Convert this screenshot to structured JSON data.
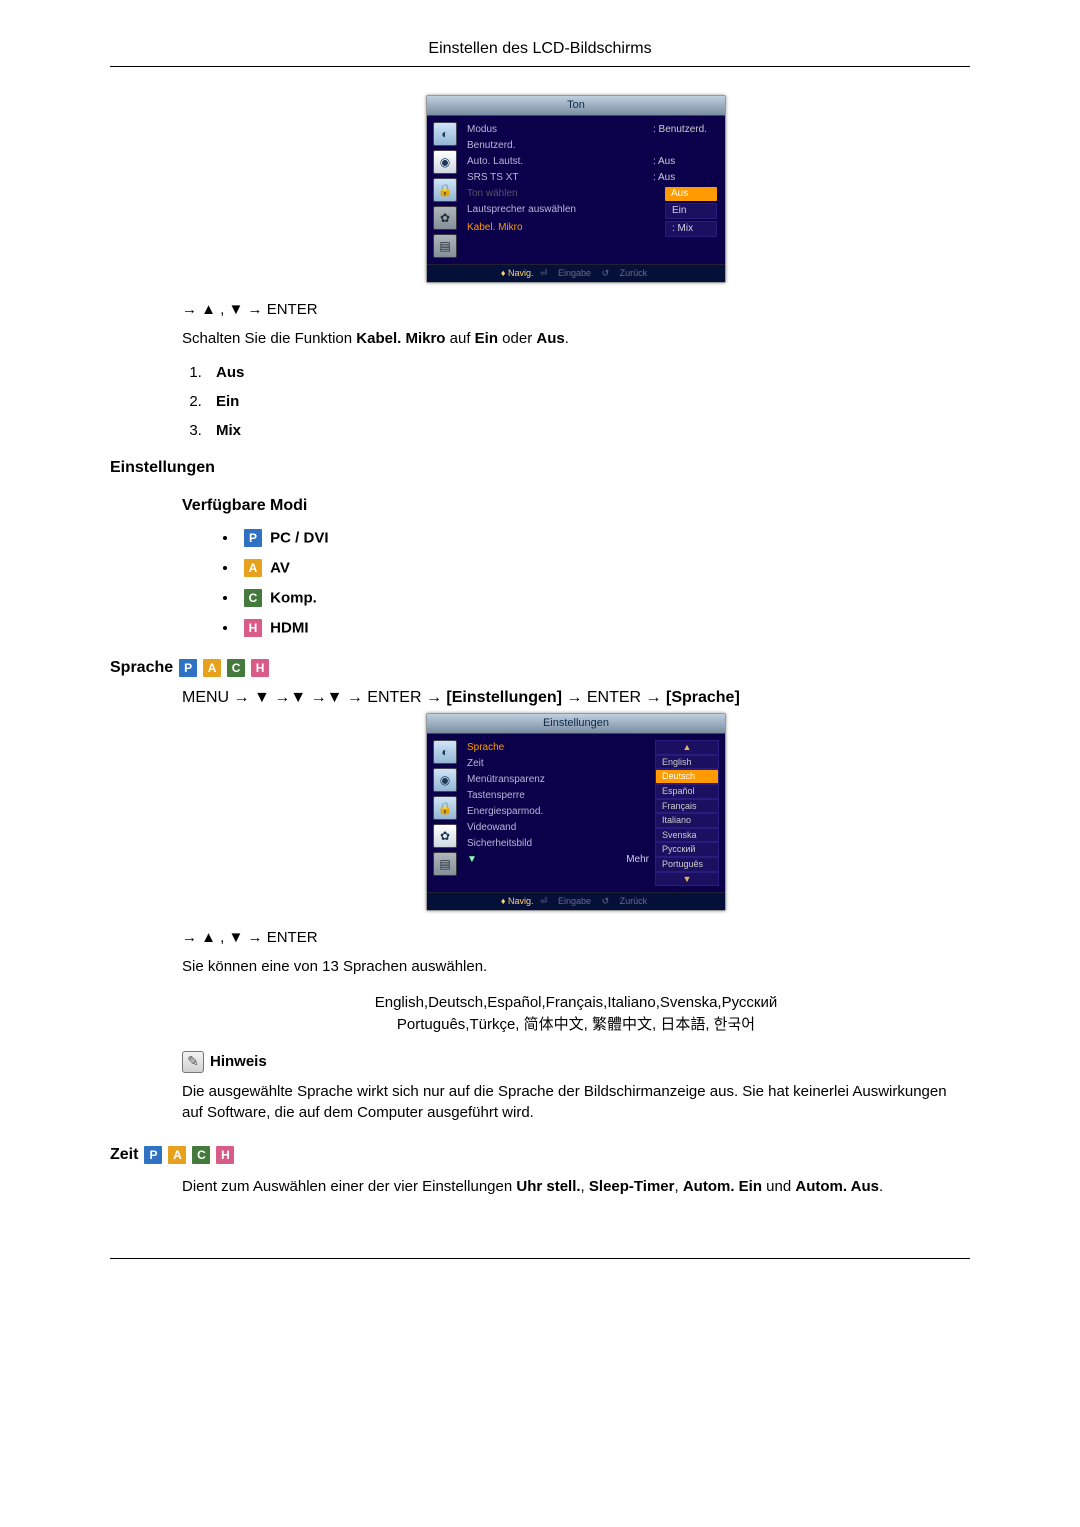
{
  "page_header": "Einstellen des LCD-Bildschirms",
  "osd1": {
    "title": "Ton",
    "rows": [
      {
        "label": "Modus",
        "value": ": Benutzerd."
      },
      {
        "label": "Benutzerd.",
        "value": ""
      },
      {
        "label": "Auto. Lautst.",
        "value": ": Aus"
      },
      {
        "label": "SRS TS XT",
        "value": ": Aus"
      },
      {
        "label_dim": "Ton wählen",
        "value_hl": "Aus"
      },
      {
        "label": "Lautsprecher auswählen",
        "value_chip": "Ein"
      },
      {
        "label_sel": "Kabel. Mikro",
        "value_chip": ": Mix"
      }
    ],
    "footer": {
      "nav": "Navig.",
      "enter": "Eingabe",
      "back": "Zurück"
    }
  },
  "nav_enter_1": "→ ▲ , ▼ → ENTER",
  "schalten_text_a": "Schalten Sie die Funktion ",
  "schalten_bold": "Kabel. Mikro",
  "schalten_text_b": " auf ",
  "schalten_ein": "Ein",
  "schalten_text_c": " oder ",
  "schalten_aus": "Aus",
  "schalten_text_d": ".",
  "optlist": [
    "Aus",
    "Ein",
    "Mix"
  ],
  "h_einstellungen": "Einstellungen",
  "h_verfuegbare": "Verfügbare Modi",
  "modes": {
    "p": "PC / DVI",
    "a": "AV",
    "c": "Komp.",
    "h": "HDMI"
  },
  "h_sprache": "Sprache",
  "menu_line": {
    "prefix": "MENU → ▼ →▼ →▼ → ENTER → ",
    "br1": "[Einstellungen]",
    "mid": " → ENTER → ",
    "br2": "[Sprache]"
  },
  "osd2": {
    "title": "Einstellungen",
    "left": [
      "Sprache",
      "Zeit",
      "Menütransparenz",
      "Tastensperre",
      "Energiesparmod.",
      "Videowand",
      "Sicherheitsbild"
    ],
    "more": "Mehr",
    "dd": [
      "English",
      "Deutsch",
      "Español",
      "Français",
      "Italiano",
      "Svenska",
      "Русский",
      "Português"
    ],
    "footer": {
      "nav": "Navig.",
      "enter": "Eingabe",
      "back": "Zurück"
    }
  },
  "nav_enter_2": "→ ▲ , ▼ → ENTER",
  "sprachen_text": "Sie können eine von 13 Sprachen auswählen.",
  "lang_fig": {
    "l1": "English,Deutsch,Español,Français,Italiano,Svenska,Русский",
    "l2": "Português,Türkçe, 简体中文,  繁體中文, 日本語, 한국어"
  },
  "hinweis_label": "Hinweis",
  "hinweis_text": "Die ausgewählte Sprache wirkt sich nur auf die Sprache der Bildschirmanzeige aus. Sie hat keinerlei Auswirkungen auf Software, die auf dem Computer ausgeführt wird.",
  "h_zeit": "Zeit",
  "zeit_text_a": "Dient zum Auswählen einer der vier Einstellungen ",
  "zeit_b1": "Uhr stell.",
  "zeit_s": ", ",
  "zeit_b2": "Sleep-Timer",
  "zeit_b3": "Autom. Ein",
  "zeit_and": " und ",
  "zeit_b4": "Autom. Aus",
  "zeit_end": "."
}
